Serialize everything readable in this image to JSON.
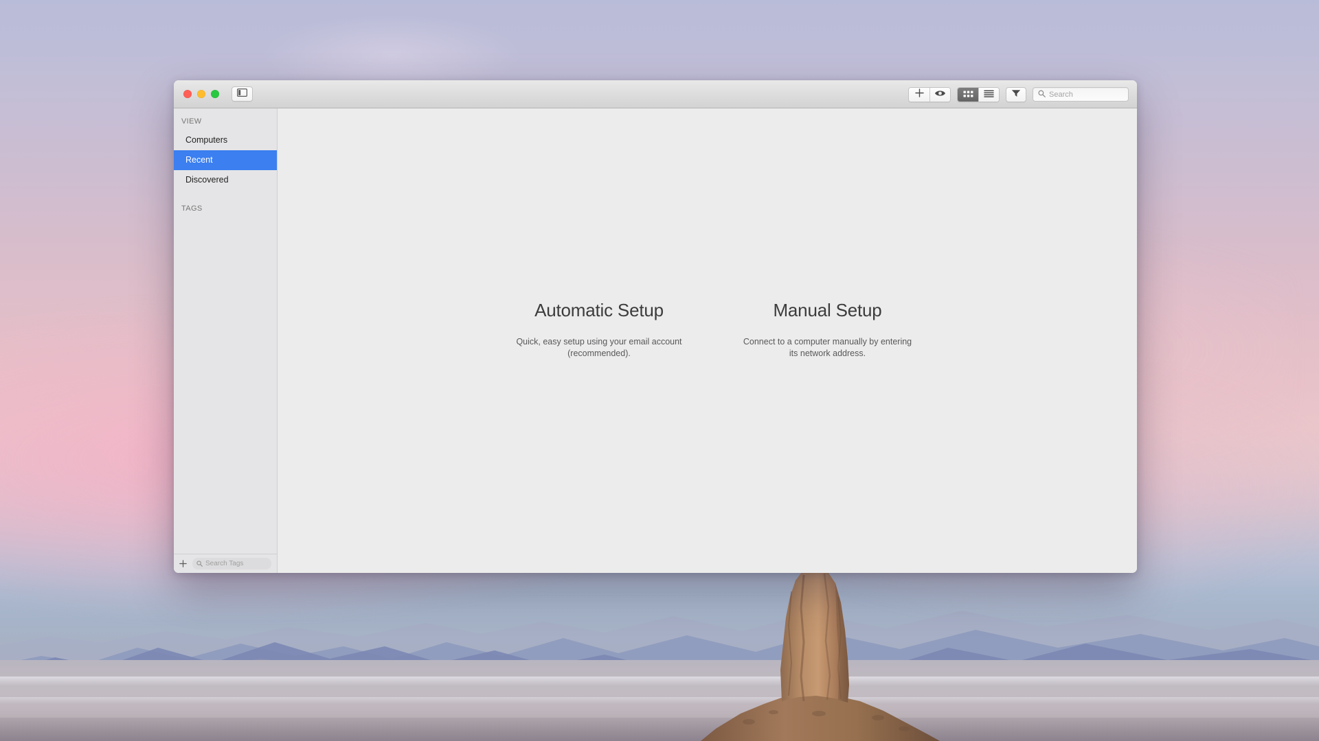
{
  "window": {
    "traffic_lights": [
      {
        "name": "close",
        "color": "#ff5f57"
      },
      {
        "name": "minimize",
        "color": "#ffbd2e"
      },
      {
        "name": "zoom",
        "color": "#28c840"
      }
    ],
    "sidebar_toggle_icon": "sidebar-toggle-icon"
  },
  "toolbar": {
    "add_icon": "plus-icon",
    "preview_icon": "eye-icon",
    "grid_view_icon": "grid-view-icon",
    "list_view_icon": "list-view-icon",
    "view_mode_selected": "grid",
    "filter_icon": "funnel-filter-icon",
    "search_icon": "search-icon",
    "search_placeholder": "Search",
    "search_value": ""
  },
  "sidebar": {
    "groups": [
      {
        "title": "VIEW",
        "items": [
          {
            "label": "Computers",
            "selected": false
          },
          {
            "label": "Recent",
            "selected": true
          },
          {
            "label": "Discovered",
            "selected": false
          }
        ]
      },
      {
        "title": "TAGS",
        "items": []
      }
    ],
    "selected_color": "#3b7ff0",
    "footer": {
      "add_icon": "plus-icon",
      "search_icon": "search-icon",
      "search_placeholder": "Search Tags",
      "search_value": ""
    }
  },
  "content": {
    "options": [
      {
        "title": "Automatic Setup",
        "description": "Quick, easy setup using your email account (recommended)."
      },
      {
        "title": "Manual Setup",
        "description": "Connect to a computer manually by entering its network address."
      }
    ]
  }
}
